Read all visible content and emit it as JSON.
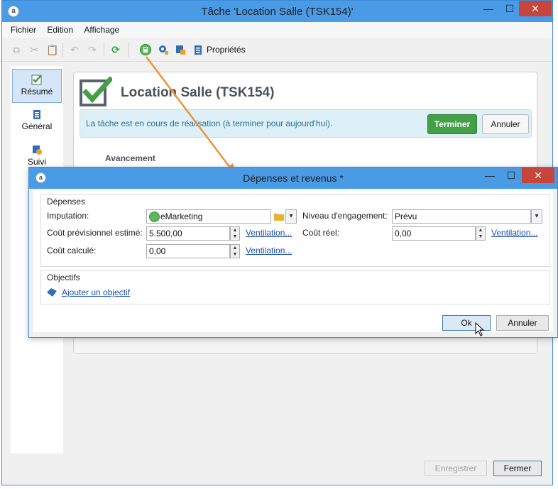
{
  "main_window": {
    "title": "Tâche 'Location Salle (TSK154)'",
    "controls": {
      "minimize": "—",
      "maximize": "☐",
      "close": "✕"
    }
  },
  "menu": [
    "Fichier",
    "Edition",
    "Affichage"
  ],
  "toolbar": {
    "properties_label": "Propriétés"
  },
  "sidebar": {
    "items": [
      {
        "label": "Résumé",
        "icon": "summary-check-icon",
        "active": true
      },
      {
        "label": "Général",
        "icon": "clipboard-icon",
        "active": false
      },
      {
        "label": "Suivi",
        "icon": "follow-up-icon",
        "active": false
      }
    ]
  },
  "task": {
    "title": "Location Salle (TSK154)",
    "status_message": "La tâche est en cours de réalisation (à terminer pour aujourd'hui).",
    "finish_button": "Terminer",
    "cancel_button": "Annuler",
    "progress_section": "Avancement"
  },
  "footer": {
    "register_button": "Enregistrer",
    "close_button": "Fermer"
  },
  "dialog": {
    "title": "Dépenses et revenus *",
    "controls": {
      "minimize": "—",
      "maximize": "☐",
      "close": "✕"
    },
    "expenses": {
      "group_title": "Dépenses",
      "imputation_label": "Imputation:",
      "imputation_value": "eMarketing",
      "engagement_label": "Niveau d'engagement:",
      "engagement_value": "Prévu",
      "estimated_cost_label": "Coût prévisionnel estimé:",
      "estimated_cost_value": "5.500,00",
      "ventilation_link": "Ventilation...",
      "real_cost_label": "Coût réel:",
      "real_cost_value": "0,00",
      "real_ventilation_link": "Ventilation...",
      "computed_cost_label": "Coût calculé:",
      "computed_cost_value": "0,00",
      "computed_ventilation_link": "Ventilation..."
    },
    "objectives": {
      "group_title": "Objectifs",
      "add_link": "Ajouter un objectif"
    },
    "ok_button": "Ok",
    "cancel_button": "Annuler"
  },
  "colors": {
    "titlebar": "#4a9be6",
    "close_button": "#c7453b",
    "finish_button": "#43a047",
    "annotation_arrow": "#f0923a",
    "link": "#1a4fb4"
  }
}
